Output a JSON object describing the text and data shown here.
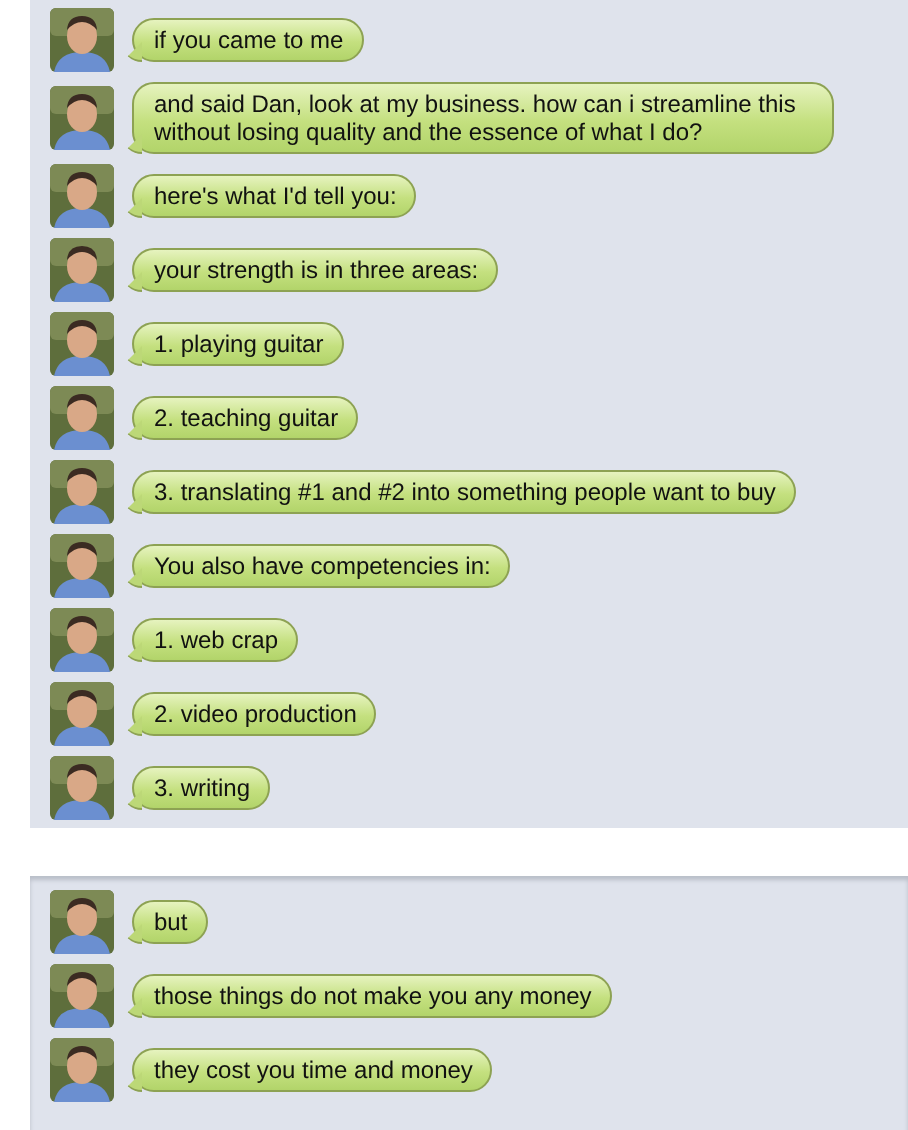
{
  "sections": [
    {
      "messages": [
        {
          "text": "if you came to me"
        },
        {
          "text": "and said Dan, look at my business. how can i streamline this without losing quality and the essence of what I do?"
        },
        {
          "text": "here's what I'd tell you:"
        },
        {
          "text": "your strength is in three areas:"
        },
        {
          "text": "1. playing guitar"
        },
        {
          "text": "2. teaching guitar"
        },
        {
          "text": "3. translating #1 and #2 into something people want to buy"
        },
        {
          "text": "You also have competencies in:"
        },
        {
          "text": "1. web crap"
        },
        {
          "text": "2. video production"
        },
        {
          "text": "3. writing"
        }
      ]
    },
    {
      "messages": [
        {
          "text": "but"
        },
        {
          "text": "those things do not make you any money"
        },
        {
          "text": "they cost you time and money"
        }
      ]
    }
  ]
}
